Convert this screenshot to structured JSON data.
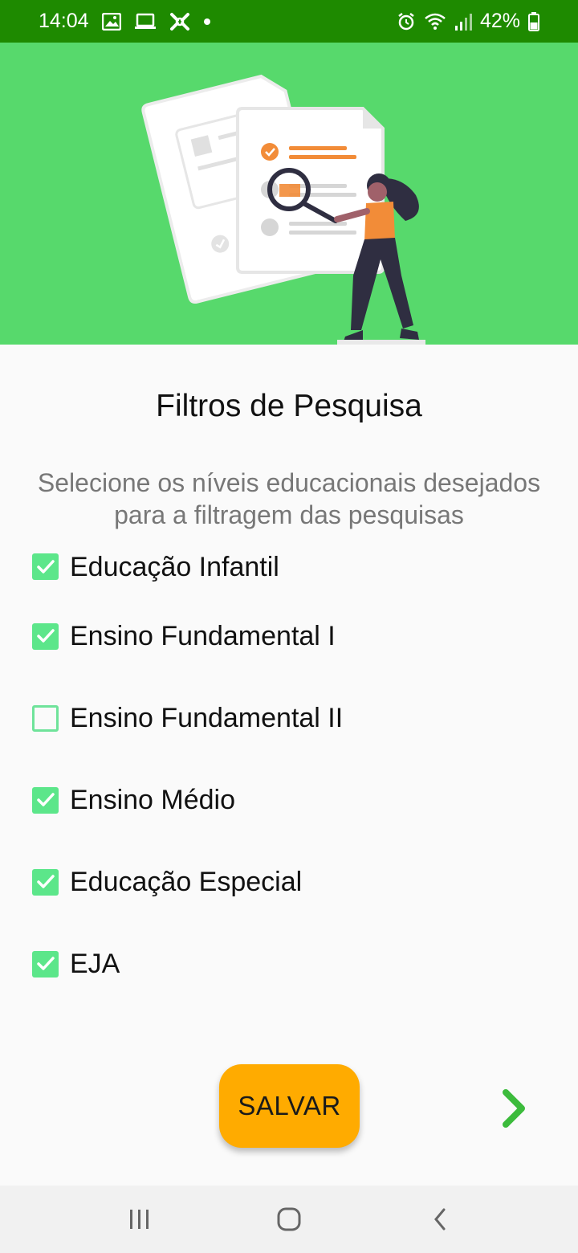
{
  "status_bar": {
    "time": "14:04",
    "battery": "42%",
    "left_icons": [
      "gallery-icon",
      "laptop-icon",
      "app-notification-icon",
      "dot-icon"
    ],
    "right_icons": [
      "alarm-icon",
      "wifi-icon",
      "signal-icon",
      "battery-icon"
    ]
  },
  "colors": {
    "status_bar": "#1e8a00",
    "hero_background": "#57d96c",
    "checkbox_accent": "#5ce68a",
    "save_button": "#ffab00",
    "next_arrow": "#3cbb3c",
    "nav_bar": "#f1f1f1"
  },
  "hero": {
    "illustration": "woman-with-magnifying-glass-over-documents"
  },
  "filters": {
    "title": "Filtros de Pesquisa",
    "subtitle": "Selecione os níveis educacionais desejados para a filtragem das pesquisas",
    "options": [
      {
        "label": "Educação Infantil",
        "checked": true
      },
      {
        "label": "Ensino Fundamental I",
        "checked": true
      },
      {
        "label": "Ensino Fundamental II",
        "checked": false
      },
      {
        "label": "Ensino Médio",
        "checked": true
      },
      {
        "label": "Educação Especial",
        "checked": true
      },
      {
        "label": "EJA",
        "checked": true
      }
    ]
  },
  "actions": {
    "save_label": "SALVAR",
    "next_icon": "chevron-right-icon"
  },
  "nav_bar": {
    "icons": [
      "recent-apps-icon",
      "home-icon",
      "back-icon"
    ]
  }
}
